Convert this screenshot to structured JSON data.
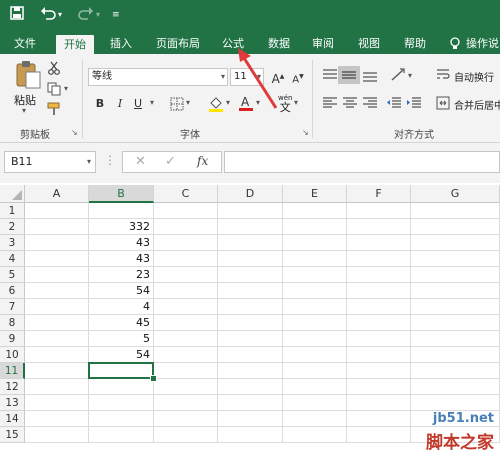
{
  "qat": {
    "save_icon": "save-icon",
    "undo_icon": "undo-icon",
    "redo_icon": "redo-icon",
    "customize_icon": "customize-qat-icon"
  },
  "tabs": [
    "文件",
    "开始",
    "插入",
    "页面布局",
    "公式",
    "数据",
    "审阅",
    "视图",
    "帮助"
  ],
  "tell_me": {
    "label": "操作说",
    "icon": "lightbulb-icon"
  },
  "ribbon": {
    "clipboard": {
      "paste_label": "粘贴",
      "group_label": "剪贴板"
    },
    "font": {
      "font_name": "等线",
      "font_size": "11",
      "bold": "B",
      "italic": "I",
      "underline": "U",
      "wen": "wén",
      "wen_char": "文",
      "group_label": "字体",
      "grow": "A",
      "shrink": "A"
    },
    "alignment": {
      "wrap_label": "自动换行",
      "merge_label": "合并后居中",
      "group_label": "对齐方式"
    }
  },
  "formula_bar": {
    "name_box": "B11",
    "fx": "fx",
    "value": ""
  },
  "columns": [
    "A",
    "B",
    "C",
    "D",
    "E",
    "F",
    "G"
  ],
  "rows": [
    "1",
    "2",
    "3",
    "4",
    "5",
    "6",
    "7",
    "8",
    "9",
    "10",
    "11",
    "12",
    "13",
    "14",
    "15"
  ],
  "column_b_values": [
    "",
    "332",
    "43",
    "43",
    "23",
    "54",
    "4",
    "45",
    "5",
    "54",
    "",
    "",
    "",
    "",
    ""
  ],
  "selected_cell": "B11",
  "accent_color": "#217346",
  "annotation": {
    "color": "#e03a3a"
  },
  "watermark": {
    "line1": "jb51.net",
    "line2": "脚本之家"
  }
}
